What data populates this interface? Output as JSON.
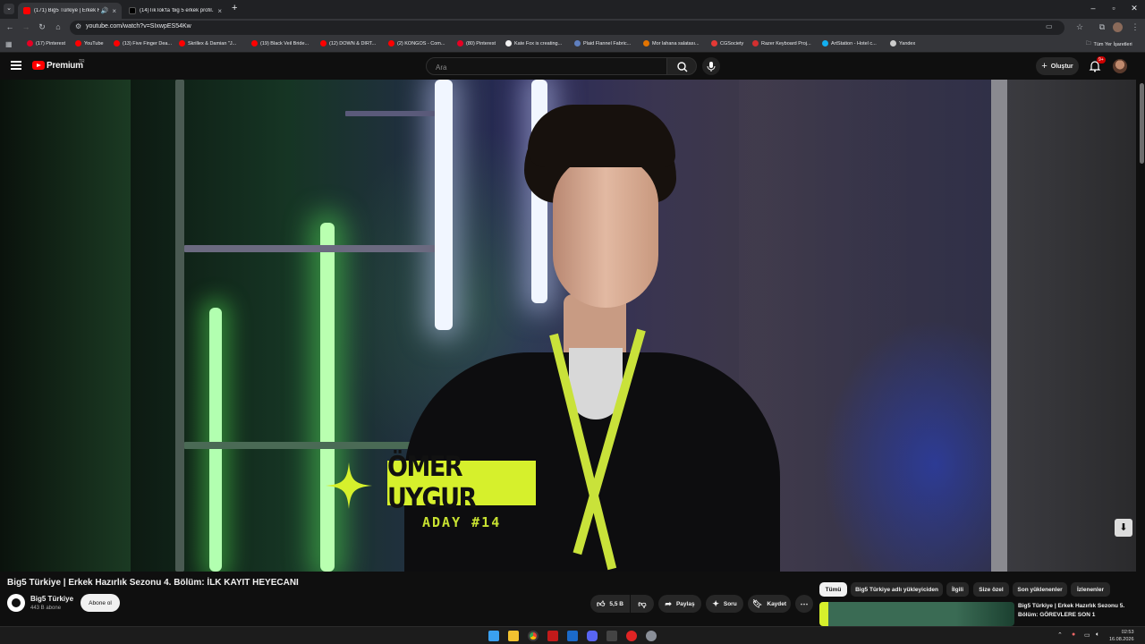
{
  "browser": {
    "tabs": [
      {
        "title": "(171) Big5 Türkiye | Erkek H...",
        "active": true,
        "favicon_color": "#ff0000"
      },
      {
        "title": "(14)TikTok'ta 'big 5 erkek profil...",
        "active": false,
        "favicon_color": "#000000"
      }
    ],
    "url": "youtube.com/watch?v=SIxwpES54Kw",
    "bookmarks": [
      {
        "label": "(17) Pinterest",
        "color": "#e60023"
      },
      {
        "label": "YouTube",
        "color": "#ff0000"
      },
      {
        "label": "(13) Five Finger Dea...",
        "color": "#ff0000"
      },
      {
        "label": "Skrillex & Damian \"J...",
        "color": "#ff0000"
      },
      {
        "label": "(19) Black Veil Bride...",
        "color": "#ff0000"
      },
      {
        "label": "(12) DOWN & DIRT...",
        "color": "#ff0000"
      },
      {
        "label": "(2) KONGOS - Com...",
        "color": "#ff0000"
      },
      {
        "label": "(80) Pinterest",
        "color": "#e60023"
      },
      {
        "label": "Kate Fox is creating...",
        "color": "#f1f1f1"
      },
      {
        "label": "Plaid Flannel Fabric...",
        "color": "#5f7fbf"
      },
      {
        "label": "Mor lahana salatası...",
        "color": "#e37400"
      },
      {
        "label": "CGSociety",
        "color": "#e53935"
      },
      {
        "label": "Razer Keyboard Proj...",
        "color": "#d32f2f"
      },
      {
        "label": "ArtStation - Hotel c...",
        "color": "#13aff0"
      },
      {
        "label": "Yandex",
        "color": "#cccccc"
      }
    ],
    "all_bookmarks_label": "Tüm Yer İşaretleri"
  },
  "youtube": {
    "brand": "Premium",
    "brand_sup": "TR",
    "search_placeholder": "Ara",
    "create_label": "Oluştur",
    "notification_badge": "9+"
  },
  "video": {
    "name_overlay": "ÖMER UYGUR",
    "candidate_label": "ADAY #14",
    "title": "Big5 Türkiye | Erkek Hazırlık Sezonu 4. Bölüm: İLK KAYIT HEYECANI",
    "channel_name": "Big5 Türkiye",
    "subscribers": "443 B abone",
    "subscribe_label": "Abone ol",
    "likes": "5,5 B",
    "share_label": "Paylaş",
    "ask_label": "Soru",
    "save_label": "Kaydet"
  },
  "sidebar": {
    "chips": [
      "Tümü",
      "Big5 Türkiye adlı yükleyiciden",
      "İlgili",
      "Size özel",
      "Son yüklenenler",
      "İzlenenler"
    ],
    "recommended_title": "Big5 Türkiye | Erkek Hazırlık Sezonu 5. Bölüm: GÖREVLERE SON 1"
  },
  "taskbar": {
    "time": "02:53",
    "date": "16.08.2026"
  },
  "colors": {
    "accent": "#ff0000",
    "name_plate": "#d6f02c"
  }
}
